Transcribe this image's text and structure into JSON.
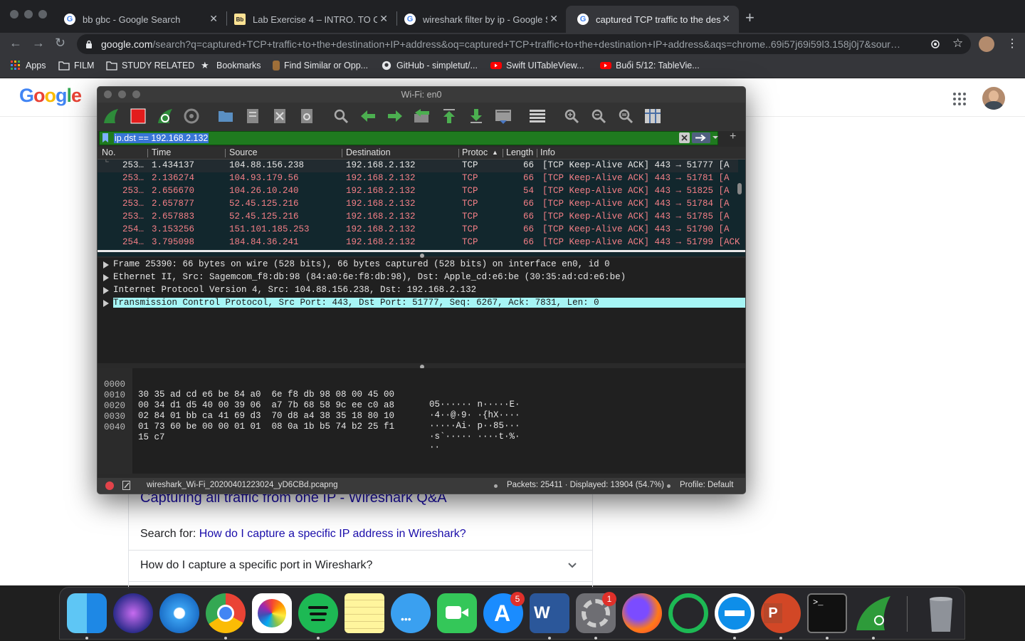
{
  "browser": {
    "tabs": [
      {
        "label": "bb gbc - Google Search",
        "icon": "google-icon"
      },
      {
        "label": "Lab Exercise 4 – INTRO. TO CYB",
        "icon": "blackboard-icon"
      },
      {
        "label": "wireshark filter by ip - Google Se",
        "icon": "google-icon"
      },
      {
        "label": "captured TCP traffic to the destin",
        "icon": "google-icon"
      }
    ],
    "url_host": "google.com",
    "url_rest": "/search?q=captured+TCP+traffic+to+the+destination+IP+address&oq=captured+TCP+traffic+to+the+destination+IP+address&aqs=chrome..69i57j69i59l3.158j0j7&sour…",
    "bookmarks": [
      {
        "label": "Apps",
        "icon": "apps-grid-icon"
      },
      {
        "label": "FILM",
        "icon": "folder-icon"
      },
      {
        "label": "STUDY RELATED",
        "icon": "folder-icon"
      },
      {
        "label": "Bookmarks",
        "icon": "star-icon"
      },
      {
        "label": "Find Similar or Opp...",
        "icon": "hand-icon"
      },
      {
        "label": "GitHub - simpletut/...",
        "icon": "github-icon"
      },
      {
        "label": "Swift UITableView...",
        "icon": "youtube-icon"
      },
      {
        "label": "Buổi 5/12: TableVie...",
        "icon": "youtube-icon"
      }
    ]
  },
  "google_page": {
    "logo": "Google",
    "result_title": "Capturing all traffic from one IP - Wireshark Q&A",
    "search_for_prefix": "Search for: ",
    "search_for_link": "How do I capture a specific IP address in Wireshark?",
    "question_1": "How do I capture a specific port in Wireshark?"
  },
  "wireshark": {
    "title": "Wi-Fi: en0",
    "filter": "ip.dst == 192.168.2.132",
    "columns": [
      "No.",
      "Time",
      "Source",
      "Destination",
      "Protoc",
      "Length",
      "Info"
    ],
    "packets": [
      {
        "no": "253…",
        "time": "1.434137",
        "src": "104.88.156.238",
        "dst": "192.168.2.132",
        "proto": "TCP",
        "len": "66",
        "info": "[TCP Keep-Alive ACK] 443 → 51777 [A"
      },
      {
        "no": "253…",
        "time": "2.136274",
        "src": "104.93.179.56",
        "dst": "192.168.2.132",
        "proto": "TCP",
        "len": "66",
        "info": "[TCP Keep-Alive ACK] 443 → 51781 [A"
      },
      {
        "no": "253…",
        "time": "2.656670",
        "src": "104.26.10.240",
        "dst": "192.168.2.132",
        "proto": "TCP",
        "len": "54",
        "info": "[TCP Keep-Alive ACK] 443 → 51825 [A"
      },
      {
        "no": "253…",
        "time": "2.657877",
        "src": "52.45.125.216",
        "dst": "192.168.2.132",
        "proto": "TCP",
        "len": "66",
        "info": "[TCP Keep-Alive ACK] 443 → 51784 [A"
      },
      {
        "no": "253…",
        "time": "2.657883",
        "src": "52.45.125.216",
        "dst": "192.168.2.132",
        "proto": "TCP",
        "len": "66",
        "info": "[TCP Keep-Alive ACK] 443 → 51785 [A"
      },
      {
        "no": "254…",
        "time": "3.153256",
        "src": "151.101.185.253",
        "dst": "192.168.2.132",
        "proto": "TCP",
        "len": "66",
        "info": "[TCP Keep-Alive ACK] 443 → 51790 [A"
      },
      {
        "no": "254…",
        "time": "3.795098",
        "src": "184.84.36.241",
        "dst": "192.168.2.132",
        "proto": "TCP",
        "len": "66",
        "info": "[TCP Keep-Alive ACK] 443 → 51799 [ACK"
      }
    ],
    "details": [
      "Frame 25390: 66 bytes on wire (528 bits), 66 bytes captured (528 bits) on interface en0, id 0",
      "Ethernet II, Src: Sagemcom_f8:db:98 (84:a0:6e:f8:db:98), Dst: Apple_cd:e6:be (30:35:ad:cd:e6:be)",
      "Internet Protocol Version 4, Src: 104.88.156.238, Dst: 192.168.2.132",
      "Transmission Control Protocol, Src Port: 443, Dst Port: 51777, Seq: 6267, Ack: 7831, Len: 0"
    ],
    "bytes": [
      {
        "off": "0000",
        "hex": "30 35 ad cd e6 be 84 a0  6e f8 db 98 08 00 45 00",
        "ascii": "05······ n·····E·"
      },
      {
        "off": "0010",
        "hex": "00 34 d1 d5 40 00 39 06  a7 7b 68 58 9c ee c0 a8",
        "ascii": "·4··@·9· ·{hX····"
      },
      {
        "off": "0020",
        "hex": "02 84 01 bb ca 41 69 d3  70 d8 a4 38 35 18 80 10",
        "ascii": "·····Ai· p··85···"
      },
      {
        "off": "0030",
        "hex": "01 73 60 be 00 00 01 01  08 0a 1b b5 74 b2 25 f1",
        "ascii": "·s`····· ····t·%·"
      },
      {
        "off": "0040",
        "hex": "15 c7",
        "ascii": "··"
      }
    ],
    "status_file": "wireshark_Wi-Fi_20200401223024_yD6CBd.pcapng",
    "status_packets": "Packets: 25411 · Displayed: 13904 (54.7%)",
    "status_profile": "Profile: Default"
  },
  "dock": {
    "apps": [
      "finder-icon",
      "siri-icon",
      "safari-icon",
      "chrome-icon",
      "photos-icon",
      "spotify-icon",
      "notes-icon",
      "messages-icon",
      "facetime-icon",
      "app-store-icon",
      "word-icon",
      "system-preferences-icon",
      "firefox-icon",
      "cleaner-icon",
      "teamviewer-icon",
      "powerpoint-icon",
      "terminal-icon",
      "wireshark-icon",
      "trash-icon"
    ],
    "app_store_badge": "5",
    "system_prefs_badge": "1"
  }
}
